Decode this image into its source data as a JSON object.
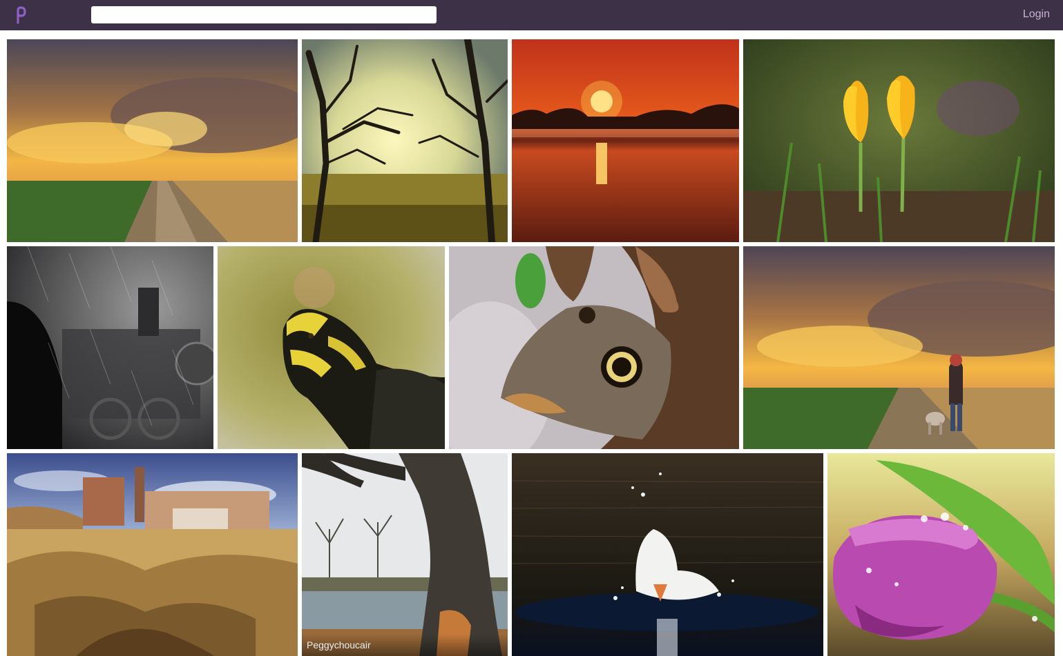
{
  "header": {
    "search_value": "",
    "login_label": "Login",
    "logo_icon": "pixabay-logo-icon",
    "background_color": "#3d3147",
    "login_color": "#c9b3d8"
  },
  "gallery": {
    "photos": [
      {
        "subject": "stormy sunset over dirt road through fields"
      },
      {
        "subject": "bare trees silhouetted against golden sky"
      },
      {
        "subject": "red sunset reflected on misty lake"
      },
      {
        "subject": "yellow crocuses in grass"
      },
      {
        "subject": "steam locomotive in rain"
      },
      {
        "subject": "yellow-bellied turtle head close-up"
      },
      {
        "subject": "owl butterfly on tree bark"
      },
      {
        "subject": "woman with dog on field road at sunset"
      },
      {
        "subject": "ruined mine buildings over eroded yellow hills"
      },
      {
        "subject": "old tree by pond with bare trees",
        "credit": "Peggychoucair"
      },
      {
        "subject": "white duck splashing in dark water"
      },
      {
        "subject": "purple tulip with water drops"
      }
    ]
  }
}
